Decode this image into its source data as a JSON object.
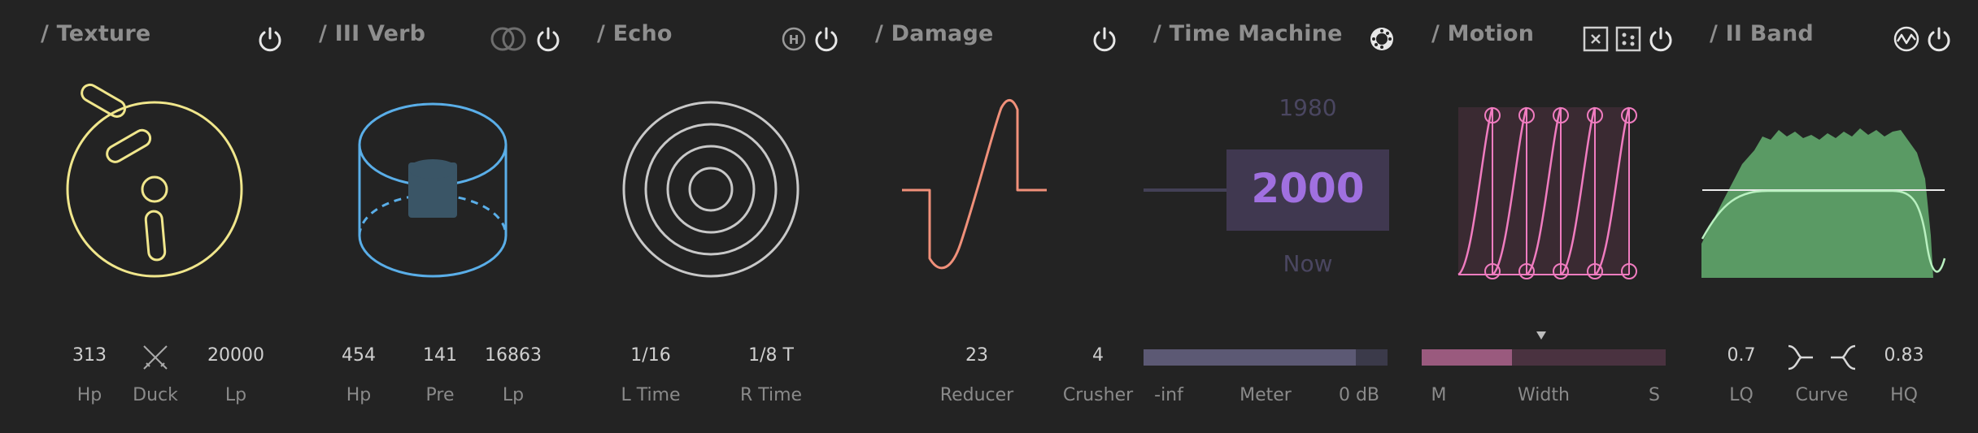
{
  "colors": {
    "background": "#232323",
    "texture": "#f0e68c",
    "verb": "#5aaee8",
    "echo": "#c8c8c8",
    "damage": "#f0907a",
    "time_machine": "#a070e0",
    "motion": "#f07cc0",
    "band": "#5a9a64"
  },
  "panels": {
    "texture": {
      "title": "/ Texture",
      "icons": [
        "power-icon"
      ],
      "params": [
        {
          "value": "313",
          "label": "Hp"
        },
        {
          "value": "",
          "label": "Duck",
          "icon": "duck-swords-icon"
        },
        {
          "value": "20000",
          "label": "Lp"
        }
      ]
    },
    "verb": {
      "title": "/ III Verb",
      "icons": [
        "stereo-rings-icon",
        "power-icon"
      ],
      "params": [
        {
          "value": "454",
          "label": "Hp"
        },
        {
          "value": "141",
          "label": "Pre"
        },
        {
          "value": "16863",
          "label": "Lp"
        }
      ]
    },
    "echo": {
      "title": "/ Echo",
      "icons": [
        "h-mode-icon",
        "power-icon"
      ],
      "params": [
        {
          "value": "1/16",
          "label": "L Time"
        },
        {
          "value": "1/8 T",
          "label": "R Time"
        }
      ]
    },
    "damage": {
      "title": "/ Damage",
      "icons": [
        "power-icon"
      ],
      "params": [
        {
          "value": "23",
          "label": "Reducer"
        },
        {
          "value": "4",
          "label": "Crusher"
        }
      ]
    },
    "time_machine": {
      "title": "/ Time Machine",
      "icons": [
        "dial-icon"
      ],
      "years": {
        "past": "1980",
        "current": "2000",
        "future": "Now"
      },
      "meter": {
        "level": 0.87,
        "labels": [
          "-inf",
          "Meter",
          "0 dB"
        ]
      }
    },
    "motion": {
      "title": "/ Motion",
      "icons": [
        "close-box-icon",
        "dots-box-icon",
        "power-icon"
      ],
      "width": {
        "level": 0.37,
        "labels": [
          "M",
          "Width",
          "S"
        ]
      }
    },
    "band": {
      "title": "/ II Band",
      "icons": [
        "waveform-icon",
        "power-icon"
      ],
      "params": [
        {
          "value": "0.7",
          "label": "LQ"
        },
        {
          "value": "",
          "label": "Curve"
        },
        {
          "value": "0.83",
          "label": "HQ"
        }
      ]
    }
  }
}
